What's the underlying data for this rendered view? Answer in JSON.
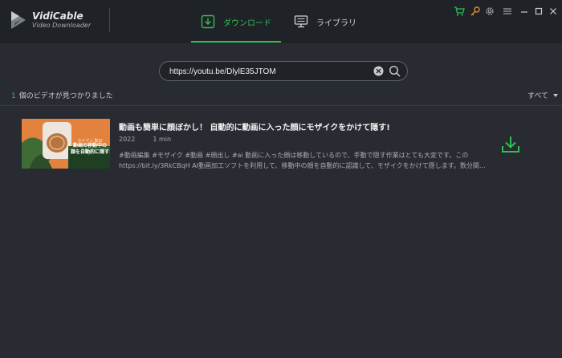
{
  "app": {
    "name": "VidiCable",
    "subtitle": "Video Downloader"
  },
  "tabs": [
    {
      "label": "ダウンロード",
      "icon": "download-icon",
      "active": true
    },
    {
      "label": "ライブラリ",
      "icon": "monitor-icon",
      "active": false
    }
  ],
  "window_controls": [
    "cart-icon",
    "key-icon",
    "gear-icon",
    "menu-icon",
    "minimize-icon",
    "maximize-icon",
    "close-icon"
  ],
  "search": {
    "value": "https://youtu.be/DlylE35JTOM",
    "icons": [
      "clear-icon",
      "search-icon"
    ]
  },
  "results": {
    "count": "1",
    "label": "個のビデオが見つかりました",
    "filter": "すべて"
  },
  "video": {
    "title": "動画も簡単に顔ぼかし！ 自動的に動画に入った顔にモザイクをかけて隠す!",
    "year": "2022",
    "duration": "1 min",
    "description": [
      "#動画編集 #モザイク #動画 #顔出し #ai 動画に入った顔は移動しているので、手動で隠す作業はとても大変です。この",
      "https://bit.ly/3RkCBqH AI動画加工ソフトを利用して、移動中の顔を自動的に認識して、モザイクをかけて隠します。数分間..."
    ],
    "thumbnail_text": [
      "動画の移動中の",
      "顔を自動的に隠す"
    ],
    "thumbnail_tag": "ライアン 取の"
  },
  "colors": {
    "accent": "#2fbf55",
    "background": "#282b31",
    "titlebar": "#1f2227",
    "thumbnail": "#e3823d"
  }
}
